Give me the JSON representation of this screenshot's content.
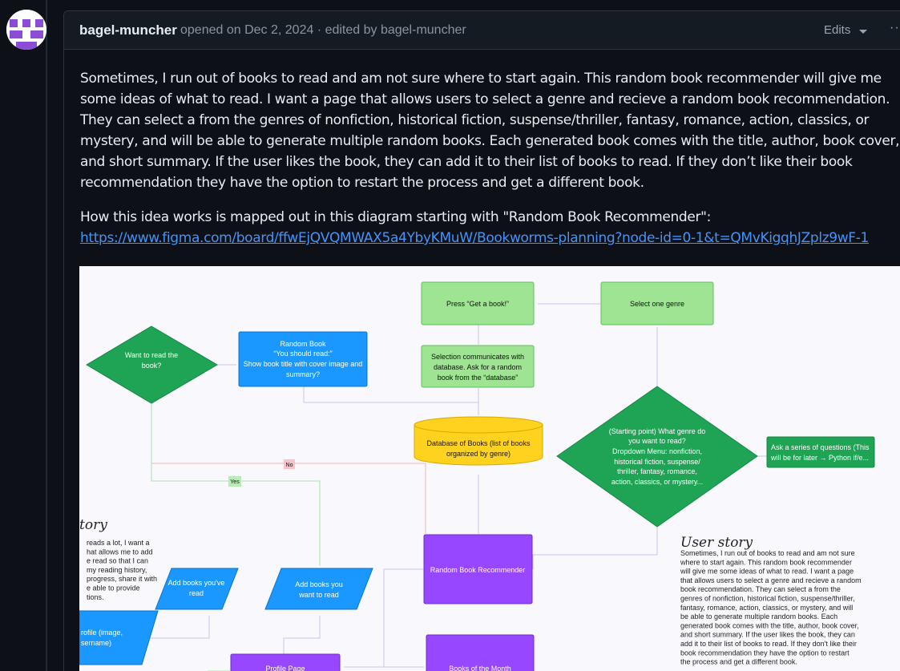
{
  "comment": {
    "author": "bagel-muncher",
    "meta": "opened on Dec 2, 2024 · edited by bagel-muncher",
    "edits_label": "Edits",
    "more_label": "··",
    "paragraph1": "Sometimes, I run out of books to read and am not sure where to start again. This random book recommender will give me some ideas of what to read. I want a page that allows users to select a genre and recieve a random book recommendation. They can select a from the genres of nonfiction, historical fiction, suspense/thriller, fantasy, romance, action, classics, or mystery, and will be able to generate multiple random books. Each generated book comes with the title, author, book cover, and short summary. If the user likes the book, they can add it to their list of books to read. If they don’t like their book recommendation they have the option to restart the process and get a different book.",
    "paragraph2_prefix": "How this idea works is mapped out in this diagram starting with \"Random Book Recommender\":",
    "link": "https://www.figma.com/board/ffwEjQVQMWAX5a4YbyKMuW/Bookworms-planning?node-id=0-1&t=QMvKigqhJZplz9wF-1"
  },
  "diagram": {
    "press_get_book": "Press “Get a book!”",
    "select_genre": "Select one genre",
    "want_to_read_1": "Want to read the",
    "want_to_read_2": "book?",
    "random_book_1": "Random Book",
    "random_book_2": "“You should read:”",
    "random_book_3": "Show book title with cover image and",
    "random_book_4": "summary?",
    "selection_1": "Selection communicates with",
    "selection_2": "database. Ask for a random",
    "selection_3": "book from the “database”",
    "database_1": "Database of Books (list of books",
    "database_2": "organized by genre)",
    "starting_1": "(Starting point) What genre do",
    "starting_2": "you want to read?",
    "starting_3": "Dropdown Menu: nonfiction,",
    "starting_4": "historical fiction, suspense/",
    "starting_5": "thriller, fantasy, romance,",
    "starting_6": "action, classics, or mystery...",
    "ask_1": "Ask a series of questions (This",
    "ask_2": "will be for later → Python if/e...",
    "no_label": "No",
    "yes_label": "Yes",
    "recommender": "Random Book Recommender",
    "add_read_1": "Add books you've",
    "add_read_2": "read",
    "add_want_1": "Add books you",
    "add_want_2": "want to read",
    "profile_1": "rofile (image,",
    "profile_2": "sername)",
    "profile_page": "Profile Page",
    "books_month": "Books of the Month",
    "left_story_title": "tory",
    "left_story": [
      "reads a lot, I want a",
      "hat allows me to add",
      "e read so that I can",
      "my reading history,",
      "progress, share it with",
      "e able to provide",
      "tions."
    ],
    "user_story_title": "User story",
    "user_story": [
      "Sometimes, I run out of books to read and am not sure",
      "where to start again. This random book recommender",
      "will give me some ideas of what to read. I want a page",
      "that allows users to select a genre and recieve a random",
      "book recommendation. They can select a from the",
      "genres of nonfiction, historical fiction, suspense/thriller,",
      "fantasy, romance, action, classics, or mystery, and will",
      "be able to generate multiple random books. Each",
      "generated book comes with the title, author, book cover,",
      "and short summary. If the user likes the book, they can",
      "add it to their list of books to read. If they don't like their",
      "book recommendation they have the option to restart",
      "the process and get a different book."
    ]
  },
  "colors": {
    "green_light": "#9ee493",
    "green_dark": "#1fa354",
    "blue": "#1a98ff",
    "yellow": "#ffd21f",
    "purple": "#9747ff",
    "avatar": "#8b4dd6"
  }
}
